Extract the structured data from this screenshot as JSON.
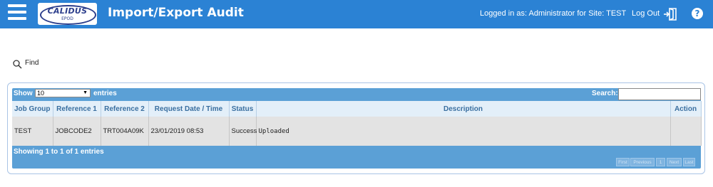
{
  "header": {
    "logo_text": "CALIDUS",
    "logo_subtext": "EPOD",
    "title": "Import/Export Audit",
    "logged_in": "Logged in as: Administrator for Site: TEST",
    "logout_label": "Log Out",
    "help_symbol": "?"
  },
  "toolbar": {
    "find_label": "Find"
  },
  "grid": {
    "show_label": "Show",
    "entries_value": "10",
    "entries_label": "entries",
    "search_label": "Search:",
    "search_value": "",
    "columns": [
      "Job Group",
      "Reference 1",
      "Reference 2",
      "Request Date / Time",
      "Status",
      "Description",
      "Action"
    ],
    "rows": [
      {
        "job_group": "TEST",
        "reference1": "JOBCODE2",
        "reference2": "TRT004A09K",
        "request_datetime": "23/01/2019 08:53",
        "status": "Success",
        "description": "Uploaded",
        "action": ""
      }
    ],
    "info": "Showing 1 to 1 of 1 entries",
    "pager": {
      "first": "First",
      "previous": "Previous",
      "page": "1",
      "next": "Next",
      "last": "Last"
    }
  },
  "colors": {
    "header_bg": "#2b82d4",
    "grid_bg": "#5ba0d6",
    "column_header_bg": "#e3eff9",
    "row_bg": "#e3e3e3"
  },
  "icons": [
    "menu-icon",
    "search-icon",
    "logout-icon",
    "help-icon",
    "dropdown-arrow-icon"
  ]
}
